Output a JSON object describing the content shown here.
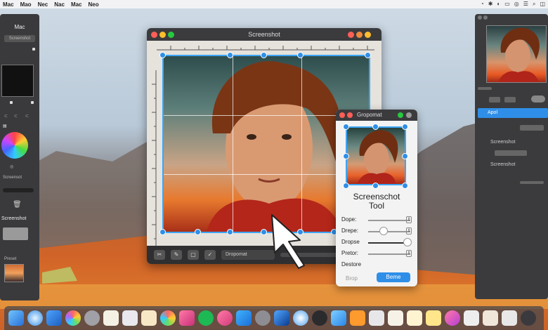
{
  "menubar": {
    "items": [
      "Mac",
      "Mao",
      "Nec",
      "Nac",
      "Mac",
      "Neo"
    ]
  },
  "left_panel": {
    "title": "Mac",
    "field_label": "Screenshot",
    "section_label": "Screensot",
    "caption": "Screenshot",
    "preset_label": "Preset"
  },
  "main_window": {
    "title": "Screenshot",
    "bottom_field": "Dropomat"
  },
  "tool_window": {
    "title": "Gropomat",
    "heading_line1": "Screenschot",
    "heading_line2": "Tool",
    "rows": [
      {
        "label": "Dope:",
        "value": 0.0
      },
      {
        "label": "Drepe:",
        "value": 0.45
      },
      {
        "label": "Dropse",
        "value": 1.0
      },
      {
        "label": "Pretor:",
        "value": 0.0
      }
    ],
    "footer_label": "Destore",
    "cancel_label": "Brop",
    "ok_label": "Beme"
  },
  "right_panel": {
    "selected_row": "Apol",
    "rows": [
      "Screenshot",
      "Screenshot",
      "Screenshot"
    ]
  },
  "colors": {
    "accent": "#2f8fe8",
    "panel": "#3b3b3e",
    "close": "#ff5f56",
    "minimize": "#ffbd2e",
    "zoom": "#27c93f"
  },
  "dock": {
    "icons": [
      "finder-icon",
      "safari-icon",
      "mail-icon",
      "photos-icon",
      "contacts-icon",
      "notes-icon",
      "reminders-icon",
      "calendar-icon",
      "photos-color-icon",
      "music-icon",
      "spotify-icon",
      "itunes-icon",
      "appstore-icon",
      "settings-icon",
      "xcode-icon",
      "safari-compass-icon",
      "screenshot-icon",
      "iterm-icon",
      "books-icon",
      "files-icon",
      "textedit-icon",
      "preview-icon",
      "notes-icon",
      "music-2-icon",
      "app-icon",
      "app-icon",
      "app-icon",
      "trash-icon"
    ]
  }
}
